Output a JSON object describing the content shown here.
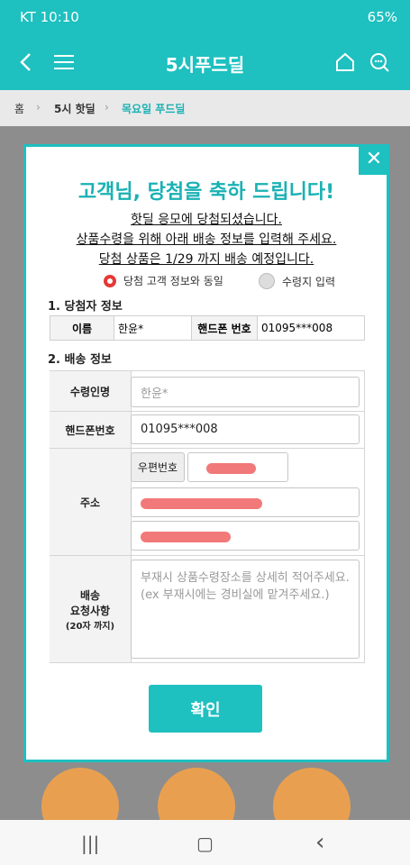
{
  "status_bar": {
    "carrier_time": "KT  10:10",
    "battery": "65%"
  },
  "header": {
    "title": "5시푸드딜"
  },
  "breadcrumb": {
    "home": "홈",
    "level1": "5시 핫딜",
    "level2": "목요일 푸드딜"
  },
  "modal": {
    "title": "고객님, 당첨을 축하 드립니다!",
    "notice_lines": [
      "핫딜 응모에 당첨되셨습니다.",
      "상품수령을 위해 아래 배송 정보를 입력해 주세요.",
      "당첨 상품은 1/29 까지 배송 예정입니다."
    ],
    "radio_same": "당첨 고객 정보와 동일",
    "radio_input": "수령지 입력",
    "section1": "1. 당첨자 정보",
    "winner": {
      "name_label": "이름",
      "name_value": "한윤*",
      "phone_label": "핸드폰 번호",
      "phone_value": "01095***008"
    },
    "section2": "2. 배송 정보",
    "shipping": {
      "recipient_label": "수령인명",
      "recipient_placeholder": "한윤*",
      "phone_label": "핸드폰번호",
      "phone_value": "01095***008",
      "address_label": "주소",
      "zip_button": "우편번호",
      "request_label_1": "배송",
      "request_label_2": "요청사항",
      "request_label_3": "(20자 까지)",
      "request_placeholder": "부재시 상품수령장소를 상세히 적어주세요. (ex 부재시에는 경비실에 맡겨주세요.)"
    },
    "confirm": "확인",
    "close_glyph": "✕"
  },
  "colors": {
    "accent": "#1ec0c0",
    "title": "#19b1b4",
    "radio_selected": "#e53935"
  },
  "nav": {
    "recent": "|||",
    "home": "▢",
    "back": "‹"
  }
}
